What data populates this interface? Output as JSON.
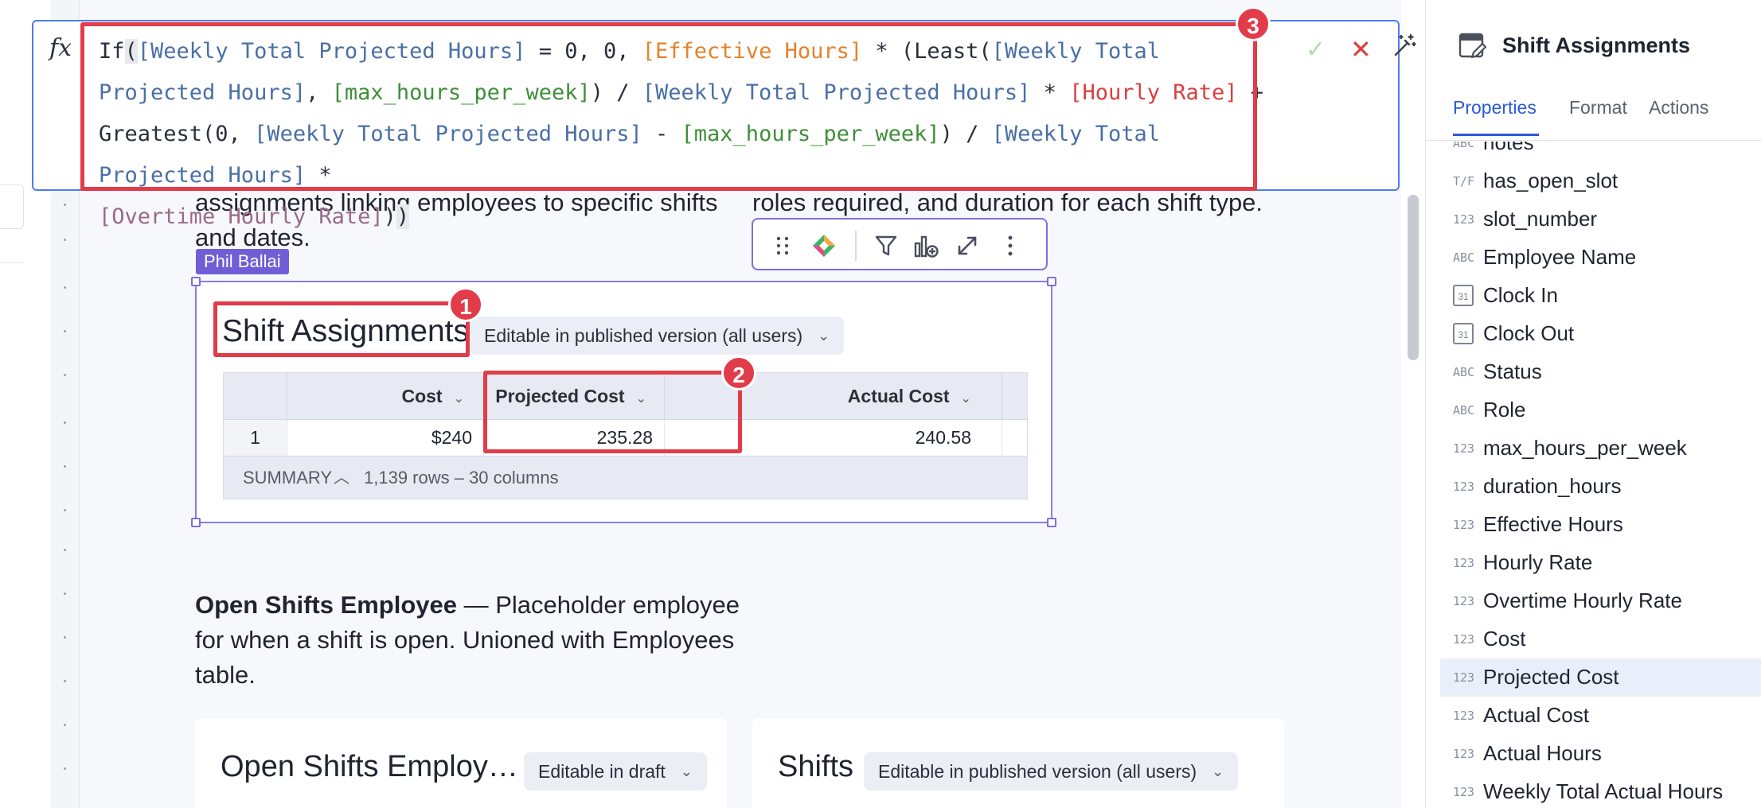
{
  "formula": {
    "fx_symbol": "fx",
    "parts": {
      "p1": "If",
      "p2": "(",
      "p3": "[Weekly Total Projected Hours]",
      "p4": " = 0, 0, ",
      "p5": "[Effective Hours]",
      "p6": " * (Least(",
      "p7": "[Weekly Total Projected Hours]",
      "p8": ", ",
      "p9": "[max_hours_per_week]",
      "p10": ") / ",
      "p11": "[Weekly Total Projected Hours]",
      "p12": " * ",
      "p13": "[Hourly Rate]",
      "p14": " + Greatest(0, ",
      "p15": "[Weekly Total Projected Hours]",
      "p16": " - ",
      "p17": "[max_hours_per_week]",
      "p18": ") / ",
      "p19": "[Weekly Total Projected Hours]",
      "p20": " * ",
      "p21": "[Overtime Hourly Rate]",
      "p22": ")",
      "p23": ")"
    },
    "confirm_symbol": "✓",
    "cancel_symbol": "✕"
  },
  "annotations": {
    "a1": "1",
    "a2": "2",
    "a3": "3"
  },
  "text_blocks": {
    "left_intro_line1": "assignments linking employees to specific shifts",
    "left_intro_line2": "and dates.",
    "right_intro": "roles required, and duration for each shift type.",
    "open_shifts_bold": "Open Shifts Employee",
    "open_shifts_line1_rest": " — Placeholder employee",
    "open_shifts_line2": "for when a shift is open. Unioned with Employees",
    "open_shifts_line3": "table."
  },
  "author_tag": "Phil Ballai",
  "table_card": {
    "title": "Shift Assignments",
    "mode_chip": "Editable in published version (all users)",
    "columns": [
      "Cost",
      "Projected Cost",
      "Actual Cost"
    ],
    "row": {
      "index": "1",
      "cost": "$240",
      "projected_cost": "235.28",
      "actual_cost": "240.58"
    },
    "summary_label": "SUMMARY",
    "summary_info": "1,139 rows – 30 columns"
  },
  "bottom_cards": [
    {
      "title": "Open Shifts Employ…",
      "chip": "Editable in draft"
    },
    {
      "title": "Shifts",
      "chip": "Editable in published version (all users)"
    }
  ],
  "panel": {
    "title": "Shift Assignments",
    "tabs": [
      "Properties",
      "Format",
      "Actions"
    ],
    "active_tab": "Properties",
    "fields": [
      {
        "type": "ABC",
        "name": "notes"
      },
      {
        "type": "T/F",
        "name": "has_open_slot"
      },
      {
        "type": "123",
        "name": "slot_number"
      },
      {
        "type": "ABC",
        "name": "Employee Name"
      },
      {
        "type": "31",
        "name": "Clock In"
      },
      {
        "type": "31",
        "name": "Clock Out"
      },
      {
        "type": "ABC",
        "name": "Status"
      },
      {
        "type": "ABC",
        "name": "Role"
      },
      {
        "type": "123",
        "name": "max_hours_per_week"
      },
      {
        "type": "123",
        "name": "duration_hours"
      },
      {
        "type": "123",
        "name": "Effective Hours"
      },
      {
        "type": "123",
        "name": "Hourly Rate"
      },
      {
        "type": "123",
        "name": "Overtime Hourly Rate"
      },
      {
        "type": "123",
        "name": "Cost"
      },
      {
        "type": "123",
        "name": "Projected Cost"
      },
      {
        "type": "123",
        "name": "Actual Cost"
      },
      {
        "type": "123",
        "name": "Actual Hours"
      },
      {
        "type": "123",
        "name": "Weekly Total Actual Hours"
      }
    ],
    "selected_field": "Projected Cost"
  },
  "colors": {
    "accent": "#2a5bd7",
    "annotation": "#e23b4a",
    "selection": "#7e6fe0",
    "author_tag": "#6f5fd6"
  }
}
